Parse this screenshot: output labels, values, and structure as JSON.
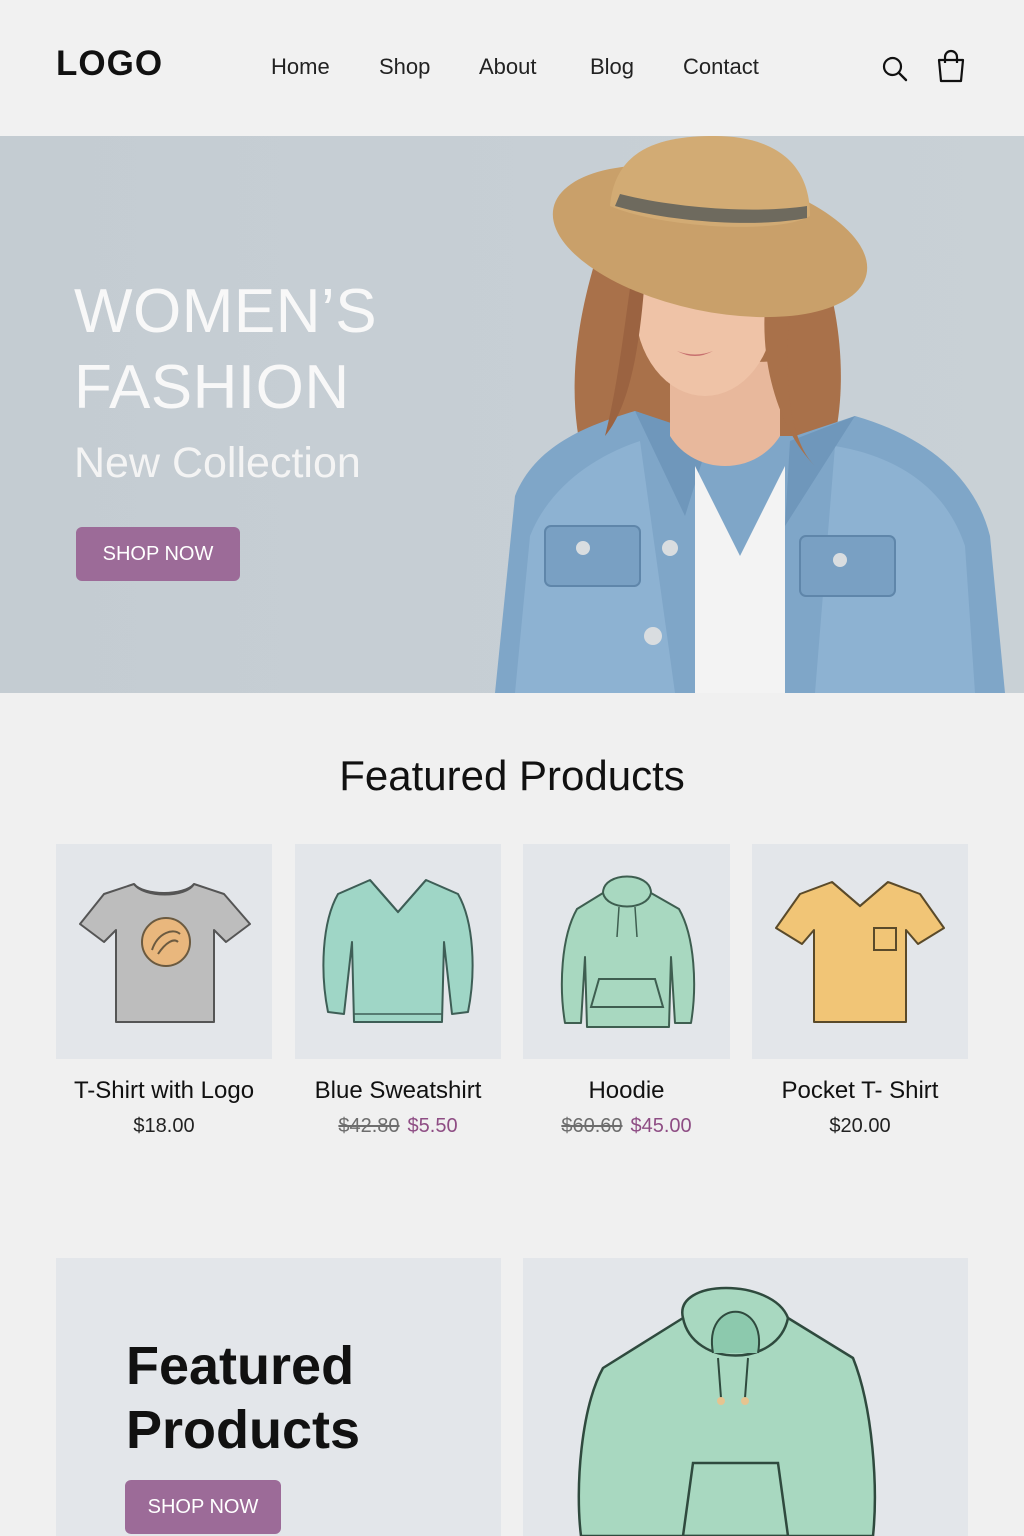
{
  "header": {
    "logo": "LOGO",
    "nav": [
      "Home",
      "Shop",
      "About",
      "Blog",
      "Contact"
    ],
    "icons": [
      "search-icon",
      "shopping-bag-icon"
    ]
  },
  "hero": {
    "title_line1": "WOMEN’S",
    "title_line2": "FASHION",
    "subtitle": "New Collection",
    "button": "SHOP NOW",
    "button_color": "#9c6b98"
  },
  "featured": {
    "title": "Featured Products",
    "products": [
      {
        "name": "T-Shirt with Logo",
        "price": "$18.00",
        "illustration": "tshirt-logo-icon"
      },
      {
        "name": "Blue Sweatshirt",
        "old_price": "$42.80",
        "sale_price": "$5.50",
        "illustration": "sweatshirt-icon"
      },
      {
        "name": "Hoodie",
        "old_price": "$60.60",
        "sale_price": "$45.00",
        "illustration": "hoodie-icon"
      },
      {
        "name": "Pocket T- Shirt",
        "price": "$20.00",
        "illustration": "pocket-tshirt-icon"
      }
    ]
  },
  "promo": {
    "title_line1": "Featured",
    "title_line2": "Products",
    "button": "SHOP NOW"
  },
  "colors": {
    "background": "#f0f0f0",
    "hero_bg": "#c7cfd5",
    "card_bg": "#e3e6ea",
    "sale_price": "#8e4d84",
    "accent_button": "#9c6b98"
  }
}
